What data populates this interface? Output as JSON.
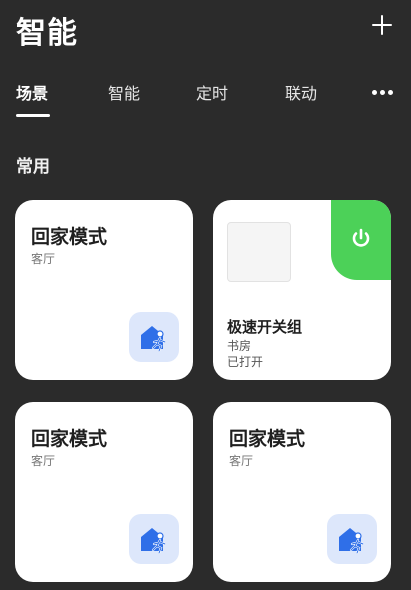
{
  "header": {
    "title": "智能"
  },
  "tabs": [
    {
      "label": "场景",
      "active": true
    },
    {
      "label": "智能",
      "active": false
    },
    {
      "label": "定时",
      "active": false
    },
    {
      "label": "联动",
      "active": false
    }
  ],
  "section": {
    "title": "常用"
  },
  "cards": [
    {
      "title": "回家模式",
      "room": "客厅",
      "icon": "home-run-icon"
    },
    {
      "title": "极速开关组",
      "room": "书房",
      "status": "已打开",
      "icon": "power-icon"
    },
    {
      "title": "回家模式",
      "room": "客厅",
      "icon": "home-run-icon"
    },
    {
      "title": "回家模式",
      "room": "客厅",
      "icon": "home-run-icon"
    }
  ],
  "colors": {
    "background": "#2b2b2b",
    "card": "#ffffff",
    "power_on": "#4cd158",
    "icon_bg": "#dde7fb",
    "icon_fg": "#2f6fe8"
  }
}
